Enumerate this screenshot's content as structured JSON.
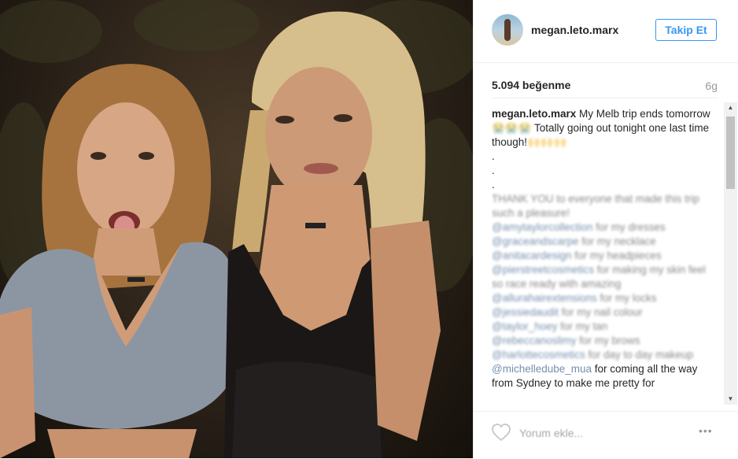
{
  "post": {
    "username": "megan.leto.marx",
    "follow_label": "Takip Et",
    "likes": "5.094 beğenme",
    "age": "6g"
  },
  "caption": {
    "username": "megan.leto.marx",
    "line1": " My Melb trip ends tomorrow ",
    "emoji1": "😭😭😭",
    "line2": " Totally going out tonight one last time though!",
    "emoji2": "🙌🙌🙌",
    "dots": "\n.\n.\n.\n",
    "thanks": "THANK YOU to everyone that made this trip such a pleasure!",
    "mention1": "@amytaylorcollection",
    "text1": " for my dresses",
    "mention2": "@graceandscarpe",
    "text2": " for my necklace",
    "mention3": "@anitacardesign",
    "text3": " for my headpieces",
    "mention4": "@pierstreetcosmetics",
    "text4": " for making my skin feel so race ready with amazing",
    "mention5": "@allurahairextensions",
    "text5": " for my locks",
    "mention6": "@jessiedaudit",
    "text6": " for my nail colour",
    "mention7": "@taylor_hoey",
    "text7": " for my tan",
    "mention8": "@rebeccanoslimy",
    "text8": " for my brows",
    "mention9": "@harlottecosmetics",
    "text9": " for day to day makeup",
    "mention10": "@michelledube_mua",
    "text10": " for coming all the way from Sydney to make me pretty for"
  },
  "footer": {
    "comment_placeholder": "Yorum ekle...",
    "more_label": "•••"
  },
  "icons": {
    "heart": "heart-icon",
    "more": "more-options-icon",
    "scroll_up": "scroll-up-arrow-icon",
    "scroll_down": "scroll-down-arrow-icon"
  },
  "colors": {
    "accent": "#3897f0",
    "link": "#003569",
    "muted": "#999999"
  }
}
